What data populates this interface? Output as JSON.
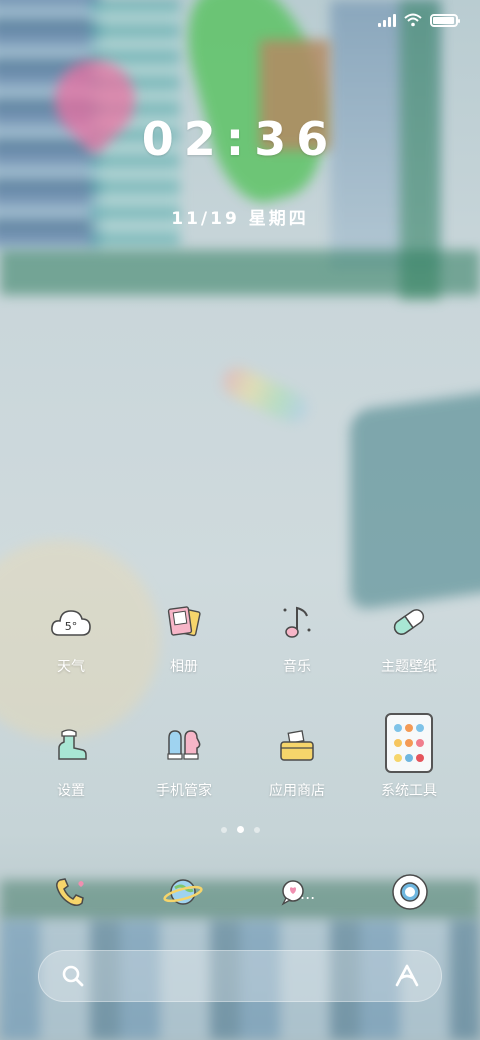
{
  "status": {
    "battery_level": 0.95
  },
  "lockscreen": {
    "time": "02:36",
    "date": "11/19 星期四"
  },
  "apps": [
    {
      "label": "天气",
      "icon": "weather-cloud-icon",
      "icon_text": "5°"
    },
    {
      "label": "相册",
      "icon": "photo-album-icon"
    },
    {
      "label": "音乐",
      "icon": "music-note-icon"
    },
    {
      "label": "主题壁纸",
      "icon": "capsule-theme-icon"
    },
    {
      "label": "设置",
      "icon": "settings-boot-icon"
    },
    {
      "label": "手机管家",
      "icon": "mittens-security-icon"
    },
    {
      "label": "应用商店",
      "icon": "basket-store-icon"
    },
    {
      "label": "系统工具",
      "icon": "folder-icon"
    }
  ],
  "page_indicator": {
    "current": 2,
    "total": 3
  },
  "dock": [
    {
      "name": "phone",
      "icon": "phone-icon"
    },
    {
      "name": "browser",
      "icon": "planet-browser-icon"
    },
    {
      "name": "messages",
      "icon": "chat-bubble-icon",
      "badge": "..."
    },
    {
      "name": "camera",
      "icon": "camera-icon"
    }
  ],
  "search": {
    "icon": "search-icon",
    "assistant_icon": "assistant-a-icon"
  },
  "colors": {
    "text": "#ffffff",
    "accent_pink": "#f08fb0",
    "accent_mint": "#a8e6d4",
    "accent_yellow": "#f6d56b"
  }
}
